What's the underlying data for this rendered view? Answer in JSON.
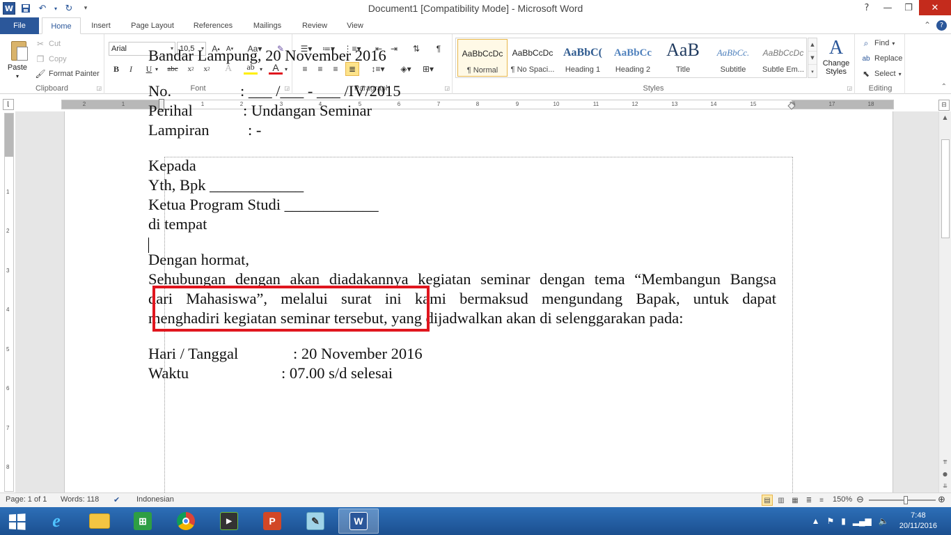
{
  "window": {
    "title": "Document1 [Compatibility Mode]  -  Microsoft Word",
    "app_logo": "W",
    "controls": [
      "?",
      "—",
      "❐",
      "✕"
    ]
  },
  "tabs": [
    {
      "label": "File"
    },
    {
      "label": "Home"
    },
    {
      "label": "Insert"
    },
    {
      "label": "Page Layout"
    },
    {
      "label": "References"
    },
    {
      "label": "Mailings"
    },
    {
      "label": "Review"
    },
    {
      "label": "View"
    }
  ],
  "ribbon": {
    "clipboard": {
      "label": "Clipboard",
      "paste": "Paste",
      "cut": "Cut",
      "copy": "Copy",
      "format_painter": "Format Painter"
    },
    "font": {
      "label": "Font",
      "font_name": "Arial",
      "font_size": "10,5"
    },
    "paragraph": {
      "label": "Paragraph"
    },
    "styles": {
      "label": "Styles",
      "items": [
        {
          "preview": "AaBbCcDc",
          "name": "¶ Normal"
        },
        {
          "preview": "AaBbCcDc",
          "name": "¶ No Spaci..."
        },
        {
          "preview": "AaBbC(",
          "name": "Heading 1"
        },
        {
          "preview": "AaBbCc",
          "name": "Heading 2"
        },
        {
          "preview": "AaB",
          "name": "Title"
        },
        {
          "preview": "AaBbCc.",
          "name": "Subtitle"
        },
        {
          "preview": "AaBbCcDc",
          "name": "Subtle Em..."
        }
      ],
      "change_styles": "Change Styles"
    },
    "editing": {
      "label": "Editing",
      "find": "Find",
      "replace": "Replace",
      "select": "Select"
    }
  },
  "ruler": {
    "h_ticks": [
      "2",
      "1",
      "1",
      "2",
      "3",
      "4",
      "5",
      "6",
      "7",
      "8",
      "9",
      "10",
      "11",
      "12",
      "13",
      "14",
      "15",
      "16",
      "17",
      "18"
    ],
    "v_ticks": [
      "1",
      "2",
      "3",
      "4",
      "5",
      "6",
      "7",
      "8"
    ]
  },
  "document": {
    "date_line": "Bandar Lampung, 20 November 2016",
    "no": {
      "label": "No.",
      "value": ": ___ /___ - ___ /IV/2015"
    },
    "perihal": {
      "label": "Perihal",
      "value": ": Undangan Seminar"
    },
    "lampiran": {
      "label": "Lampiran",
      "value": ": -"
    },
    "kepada": "Kepada",
    "yth": "Yth, Bpk ____________",
    "ketua": "Ketua Program Studi ____________",
    "tempat": "di tempat",
    "salam": "Dengan hormat,",
    "body_line1": "Sehubungan dengan akan diadakannya kegiatan seminar dengan tema “Membangun Bangsa",
    "body_line2": "dari Mahasiswa”, melalui surat ini kami bermaksud mengundang Bapak, untuk dapat",
    "body_line3": "menghadiri kegiatan seminar tersebut, yang dijadwalkan akan di selenggarakan pada:",
    "hari": {
      "label": "Hari / Tanggal",
      "value": ": 20 November 2016"
    },
    "waktu": {
      "label": "Waktu",
      "value": ": 07.00 s/d selesai"
    }
  },
  "statusbar": {
    "page": "Page: 1 of 1",
    "words": "Words: 118",
    "language": "Indonesian",
    "zoom": "150%"
  },
  "taskbar": {
    "apps": [
      "Internet Explorer",
      "File Explorer",
      "Store",
      "Chrome",
      "Media",
      "PowerPoint",
      "Notepad",
      "Word"
    ],
    "time": "7:48",
    "date": "20/11/2016"
  },
  "colors": {
    "accent": "#2b579a",
    "highlight_box": "#e0161e",
    "taskbar": "#1f5fa6"
  }
}
